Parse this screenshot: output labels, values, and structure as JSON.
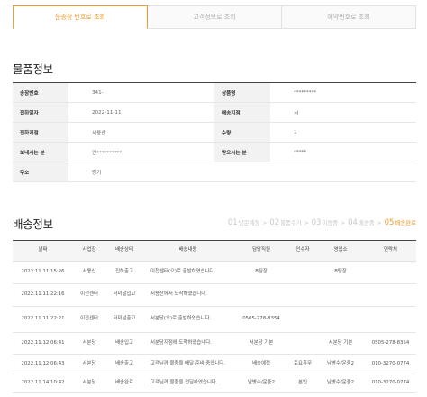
{
  "tabs": [
    {
      "label": "운송장 번호로 조회",
      "active": true
    },
    {
      "label": "고객정보로 조회",
      "active": false
    },
    {
      "label": "예약번호로 조회",
      "active": false
    }
  ],
  "product_section": {
    "title": "물품정보",
    "rows": [
      {
        "k1": "송장번호",
        "v1": "341-",
        "k2": "상품명",
        "v2": "*********"
      },
      {
        "k1": "집하일자",
        "v1": "2022-11-11",
        "k2": "배송지점",
        "v2": "서"
      },
      {
        "k1": "집하지점",
        "v1": "서용산",
        "k2": "수량",
        "v2": "1"
      },
      {
        "k1": "보내시는 분",
        "v1": "인**********",
        "k2": "받으시는 분",
        "v2": "*****"
      }
    ],
    "address": {
      "k": "주소",
      "v": "경기"
    }
  },
  "delivery_section": {
    "title": "배송정보",
    "steps": [
      {
        "num": "01",
        "label": "방문예정",
        "active": false
      },
      {
        "num": "02",
        "label": "물품수거",
        "active": false
      },
      {
        "num": "03",
        "label": "이동중",
        "active": false
      },
      {
        "num": "04",
        "label": "배송중",
        "active": false
      },
      {
        "num": "05",
        "label": "배송완료",
        "active": true
      }
    ],
    "columns": [
      "날짜",
      "사업장",
      "배송상태",
      "배송내용",
      "담당직원",
      "인수자",
      "영업소",
      "연락처"
    ],
    "rows": [
      {
        "date": "2022.11.11 15:26",
        "site": "서용산",
        "status": "집하출고",
        "content": "이천센터(으)로 출발하였습니다.",
        "staff": "B팀장",
        "receiver": "",
        "office": "B팀장",
        "phone": ""
      },
      {
        "date": "2022.11.11 22:16",
        "site": "이천센터",
        "status": "터미널입고",
        "content": "서용산에서 도착하였습니다.",
        "staff": "",
        "receiver": "",
        "office": "",
        "phone": ""
      },
      {
        "date": "2022.11.11 22:21",
        "site": "이천센터",
        "status": "터미널출고",
        "content": "서분당(으)로 출발하였습니다.",
        "staff": "0505-278-8354",
        "receiver": "",
        "office": "",
        "phone": ""
      },
      {
        "date": "2022.11.12 06:41",
        "site": "서분당",
        "status": "배송입고",
        "content": "서분당지점에 도착하였습니다.",
        "staff": "서분당 기본",
        "receiver": "",
        "office": "서분당 기본",
        "phone": "0505-278-8354"
      },
      {
        "date": "2022.11.12 06:43",
        "site": "서분당",
        "status": "배송출고",
        "content": "고객님께 물품을 배달 준비 중입니다.",
        "staff": "배송예정",
        "receiver": "토요휴무",
        "office": "남병수/운중2",
        "phone": "010-3270-0774"
      },
      {
        "date": "2022.11.14 10:42",
        "site": "서분당",
        "status": "배송완료",
        "content": "고객님께 물품을 전달하였습니다.",
        "staff": "남병수/운중2",
        "receiver": "본인",
        "office": "남병수/운중2",
        "phone": "010-3270-0774"
      }
    ]
  },
  "colors": {
    "accent": "#f39a2c",
    "header_bg": "#f2f2f2"
  }
}
